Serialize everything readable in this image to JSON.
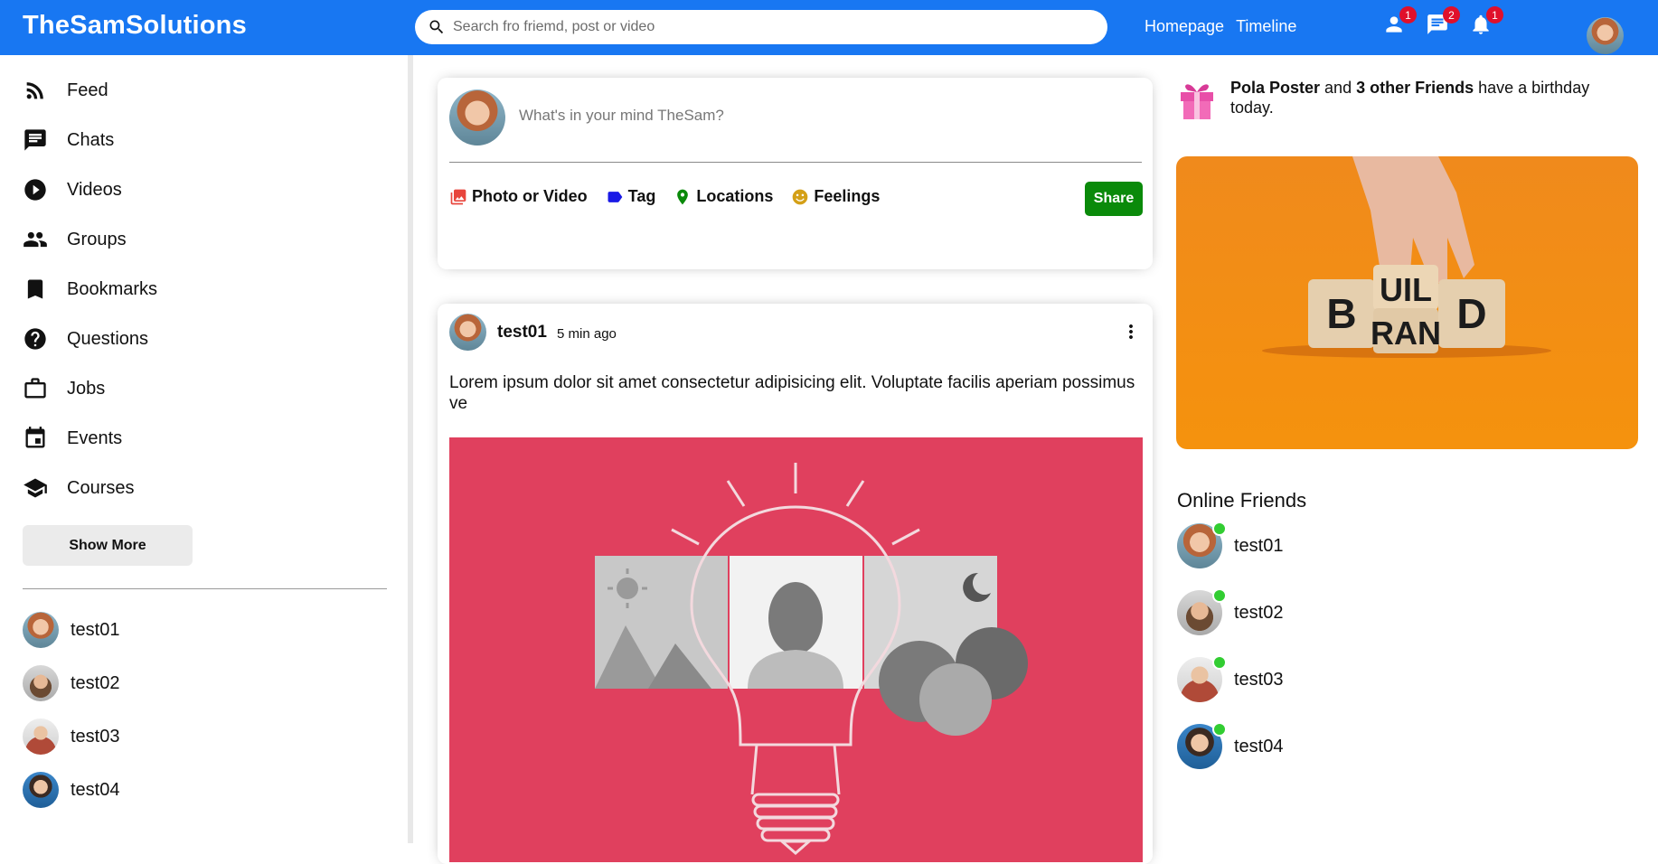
{
  "app": {
    "logo": "TheSamSolutions"
  },
  "search": {
    "placeholder": "Search fro friemd, post or video"
  },
  "top_links": [
    "Homepage",
    "Timeline"
  ],
  "notifications": [
    {
      "icon": "person-icon",
      "count": "1"
    },
    {
      "icon": "chat-icon",
      "count": "2"
    },
    {
      "icon": "bell-icon",
      "count": "1"
    }
  ],
  "sidebar": {
    "items": [
      {
        "label": "Feed",
        "icon": "rss-feed-icon"
      },
      {
        "label": "Chats",
        "icon": "chat-icon"
      },
      {
        "label": "Videos",
        "icon": "play-circle-icon"
      },
      {
        "label": "Groups",
        "icon": "group-icon"
      },
      {
        "label": "Bookmarks",
        "icon": "bookmark-icon"
      },
      {
        "label": "Questions",
        "icon": "help-circle-icon"
      },
      {
        "label": "Jobs",
        "icon": "briefcase-icon"
      },
      {
        "label": "Events",
        "icon": "calendar-icon"
      },
      {
        "label": "Courses",
        "icon": "graduation-cap-icon"
      }
    ],
    "show_more": "Show More",
    "friends": [
      "test01",
      "test02",
      "test03",
      "test04"
    ]
  },
  "share": {
    "placeholder": "What's in your mind TheSam?",
    "options": [
      {
        "label": "Photo or Video",
        "icon": "photo-icon",
        "color": "#e8453c"
      },
      {
        "label": "Tag",
        "icon": "label-icon",
        "color": "#1a1ae6"
      },
      {
        "label": "Locations",
        "icon": "location-pin-icon",
        "color": "#0a8a0a"
      },
      {
        "label": "Feelings",
        "icon": "emoji-icon",
        "color": "#d4a017"
      }
    ],
    "button": "Share"
  },
  "post": {
    "user": "test01",
    "time": "5 min ago",
    "text": "Lorem ipsum dolor sit amet consectetur adipisicing elit. Voluptate facilis aperiam possimus ve"
  },
  "birthday": {
    "name": "Pola Poster",
    "connector": " and ",
    "others": "3 other Friends",
    "suffix": " have a birthday today."
  },
  "ad": {
    "blocks": [
      "B",
      "UIL",
      "RAN",
      "D"
    ]
  },
  "online": {
    "title": "Online Friends",
    "friends": [
      "test01",
      "test02",
      "test03",
      "test04"
    ]
  },
  "colors": {
    "brand": "#1877f2",
    "share_button": "#0a8a0a",
    "badge": "#e0102b",
    "online": "#32cd32"
  }
}
